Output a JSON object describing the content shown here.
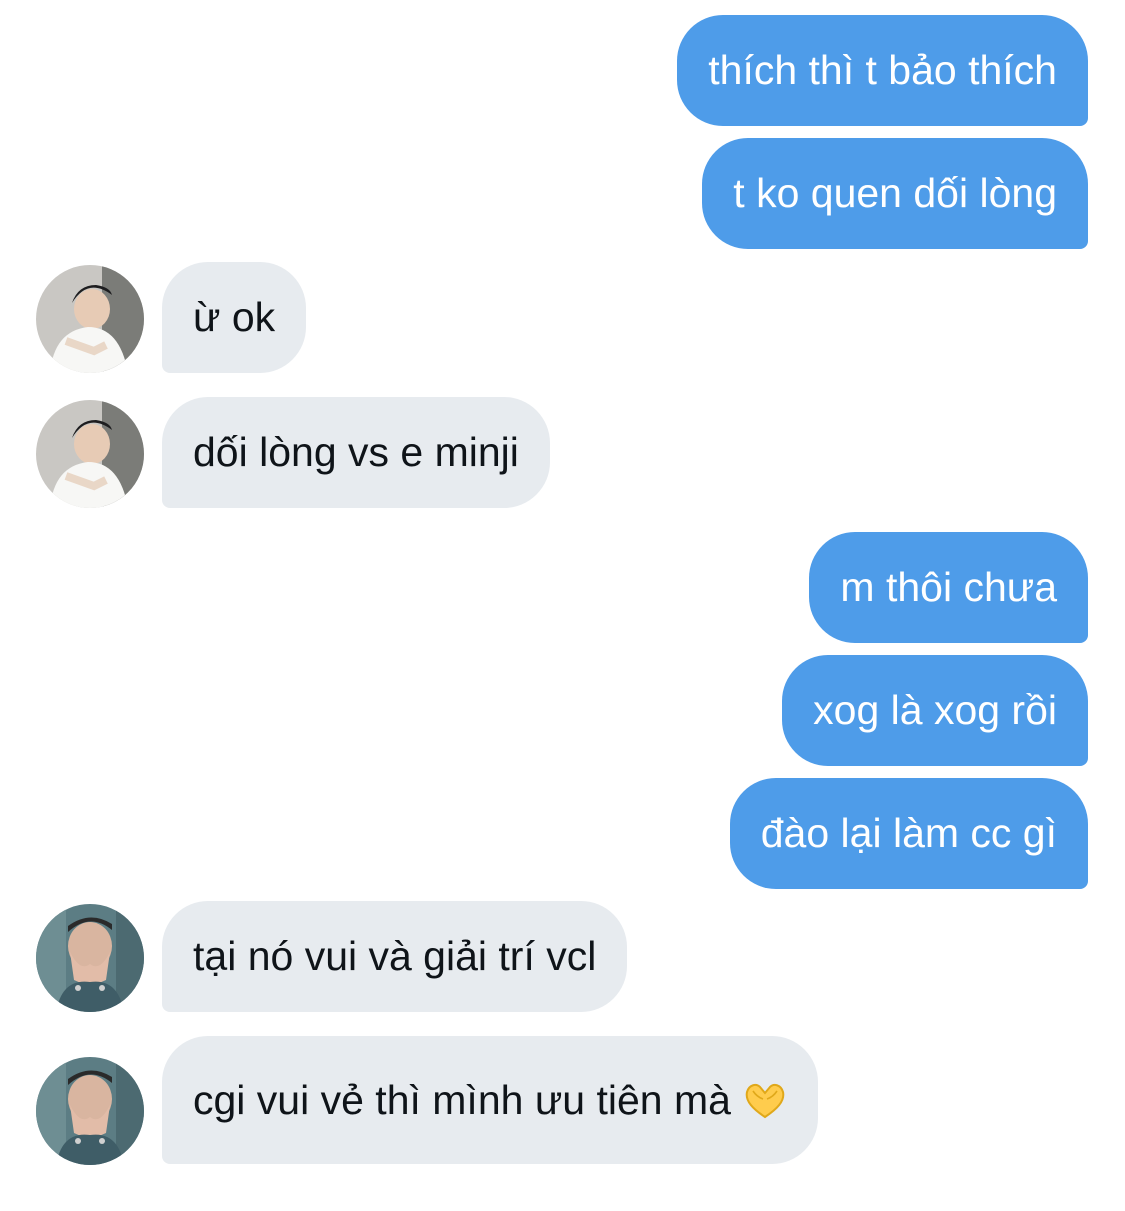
{
  "colors": {
    "outgoing_bubble": "#4e9ce9",
    "incoming_bubble": "#e7ebef",
    "outgoing_text": "#ffffff",
    "incoming_text": "#0f1419"
  },
  "messages": [
    {
      "direction": "outgoing",
      "text": "thích thì t bảo thích"
    },
    {
      "direction": "outgoing",
      "text": "t ko quen dối lòng"
    },
    {
      "direction": "incoming",
      "sender_avatar": "avatar-white-shirt",
      "text": "ừ ok"
    },
    {
      "direction": "incoming",
      "sender_avatar": "avatar-white-shirt",
      "text": "dối lòng vs e minji"
    },
    {
      "direction": "outgoing",
      "text": "m thôi chưa"
    },
    {
      "direction": "outgoing",
      "text": "xog là xog rồi"
    },
    {
      "direction": "outgoing",
      "text": "đào lại làm cc gì"
    },
    {
      "direction": "incoming",
      "sender_avatar": "avatar-hands-face",
      "text": "tại nó vui và giải trí vcl"
    },
    {
      "direction": "incoming",
      "sender_avatar": "avatar-hands-face",
      "text": "cgi vui vẻ thì mình ưu tiên mà",
      "emoji": "heart-hands-emoji"
    }
  ]
}
